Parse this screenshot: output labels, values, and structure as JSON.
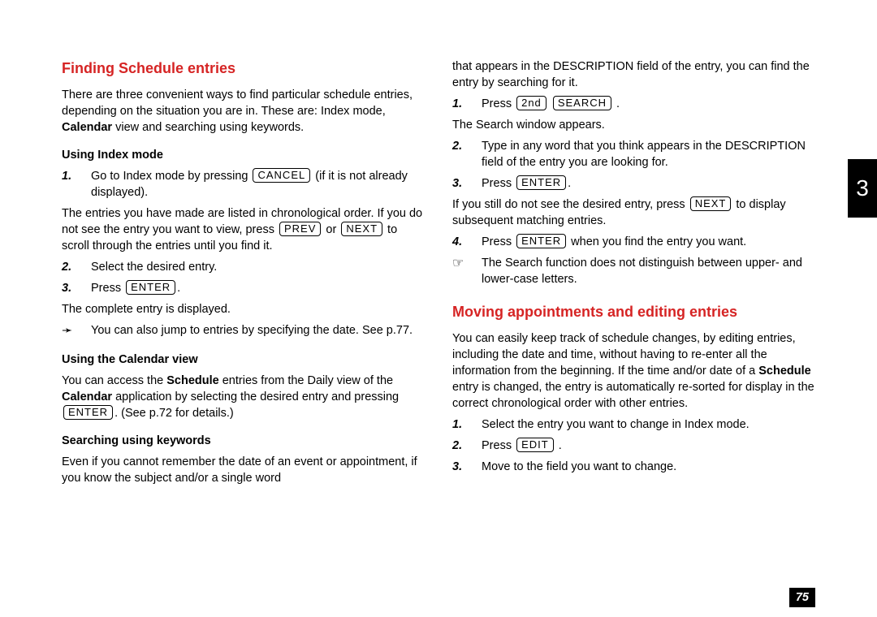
{
  "thumb_tab": "3",
  "page_num": "75",
  "left": {
    "h_finding": "Finding Schedule entries",
    "intro_a": "There are three convenient ways to find particular schedule entries, depending on the situation you are in. These are: Index mode, ",
    "intro_b_bold": "Calendar",
    "intro_c": " view and searching using keywords.",
    "sub_index": "Using Index mode",
    "s1_a": "Go to Index mode by pressing ",
    "s1_key": "CANCEL",
    "s1_b": " (if it is not already displayed).",
    "index_para_a": "The entries you have made are listed in chronological order. If you do not see the entry you want to view, press ",
    "key_prev": "PREV",
    "index_para_b": " or ",
    "key_next": "NEXT",
    "index_para_c": " to scroll through the entries until you find it.",
    "s2": "Select the desired entry.",
    "s3_a": "Press ",
    "key_enter": "ENTER",
    "s3_b": ".",
    "complete_para": "The complete entry is displayed.",
    "note_jump": "You can also jump to entries by specifying the date. See p.77.",
    "sub_calendar": "Using the Calendar view",
    "cal_a": "You can access the ",
    "cal_b_bold": "Schedule",
    "cal_c": " entries from the Daily view of the ",
    "cal_d_bold": "Calendar",
    "cal_e": " application by selecting the desired entry and pressing ",
    "cal_f": ". (See p.72 for details.)",
    "sub_search": "Searching using keywords",
    "search_para": "Even if you cannot remember the date of an event or appointment, if you know the subject and/or a single word"
  },
  "right": {
    "cont_para": "that appears in the DESCRIPTION field of the entry, you can find the entry by searching for it.",
    "r1_a": "Press ",
    "key_2nd": "2nd",
    "key_search": "SEARCH",
    "r1_b": " .",
    "search_window": "The Search window appears.",
    "r2": "Type in any word that you think appears in the DESCRIPTION field of the entry you are looking for.",
    "r3_a": "Press ",
    "r3_b": ".",
    "still_a": "If you still do not see the desired entry, press ",
    "still_b": " to display subsequent matching entries.",
    "r4_a": "Press ",
    "r4_b": " when you find the entry you want.",
    "note_case": "The Search function does not distinguish between upper- and lower-case letters.",
    "h_moving": "Moving appointments and editing entries",
    "mov_a": "You can easily keep track of schedule changes, by editing entries, including the date and time, without having to re-enter all the information from the beginning. If the time and/or date of a ",
    "mov_b_bold": "Schedule",
    "mov_c": " entry is changed, the entry is automatically re-sorted for display in the correct chronological order with other entries.",
    "m1": "Select the entry you want to change in Index mode.",
    "m2_a": "Press ",
    "key_edit": "EDIT",
    "m2_b": " .",
    "m3": "Move to the field you want to change."
  },
  "nums": {
    "n1": "1.",
    "n2": "2.",
    "n3": "3.",
    "n4": "4."
  }
}
